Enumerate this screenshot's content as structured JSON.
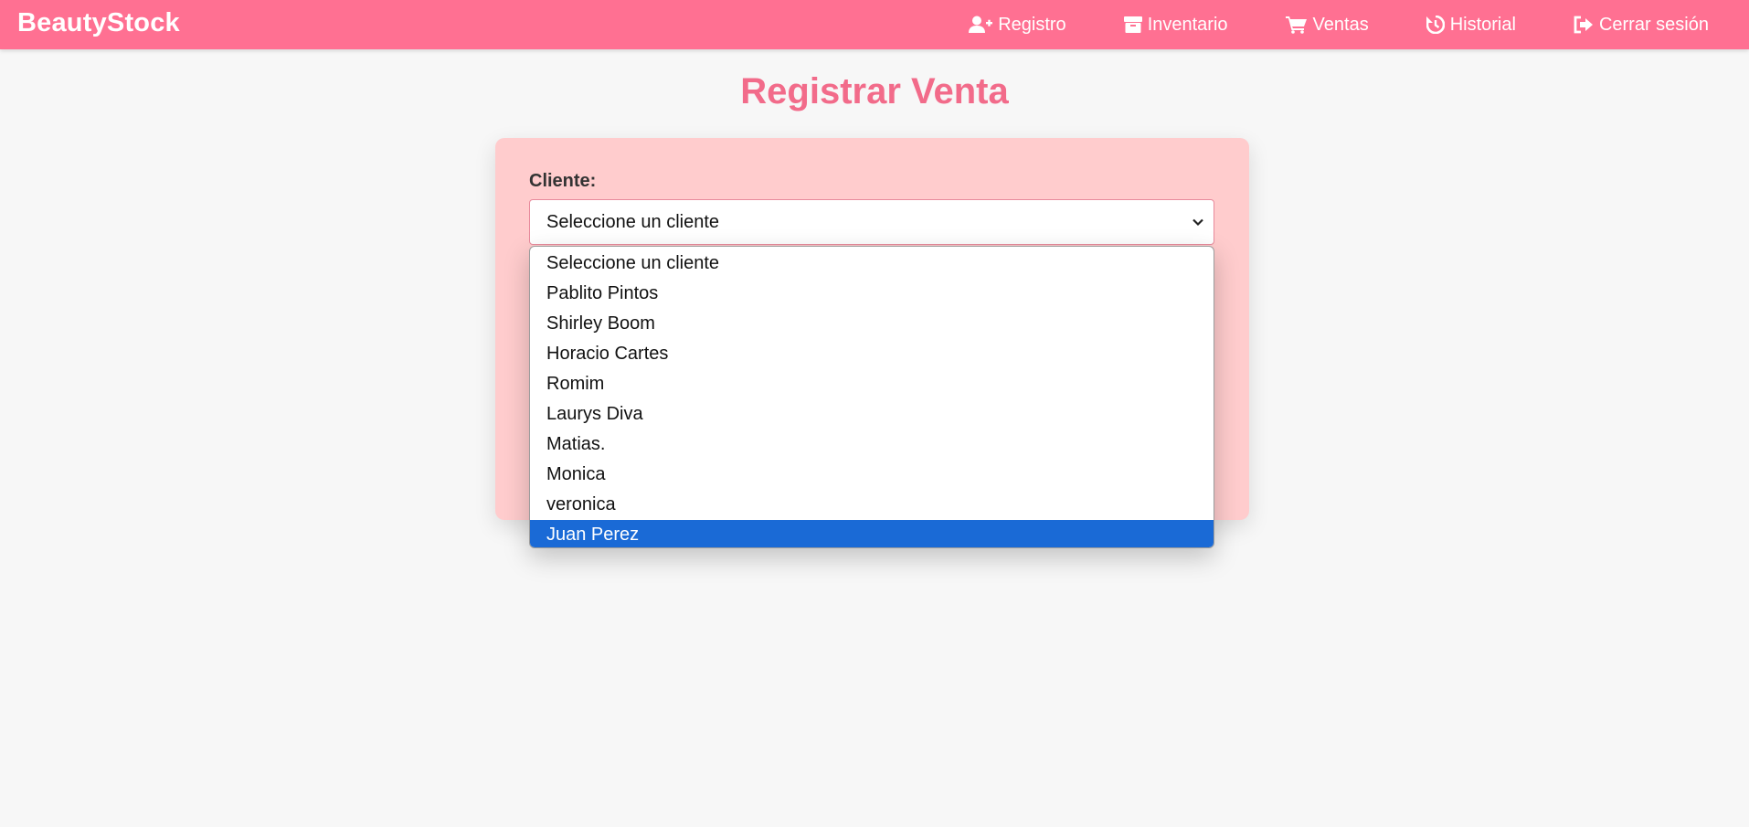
{
  "brand": "BeautyStock",
  "nav": [
    {
      "label": "Registro",
      "icon": "user-plus-icon"
    },
    {
      "label": "Inventario",
      "icon": "box-icon"
    },
    {
      "label": "Ventas",
      "icon": "cart-icon"
    },
    {
      "label": "Historial",
      "icon": "history-icon"
    },
    {
      "label": "Cerrar sesión",
      "icon": "sign-out-icon"
    }
  ],
  "page_title": "Registrar Venta",
  "form": {
    "client_label": "Cliente:",
    "client_selected": "Seleccione un cliente",
    "client_options": [
      "Seleccione un cliente",
      "Pablito Pintos",
      "Shirley Boom",
      "Horacio Cartes",
      "Romim",
      "Laurys Diva",
      "Matias.",
      "Monica",
      "veronica",
      "Juan Perez"
    ],
    "highlighted_option": "Juan Perez"
  },
  "colors": {
    "navbar": "#ff7092",
    "title": "#f26b8a",
    "card": "#ffcccd",
    "highlight": "#1a6ad6"
  }
}
